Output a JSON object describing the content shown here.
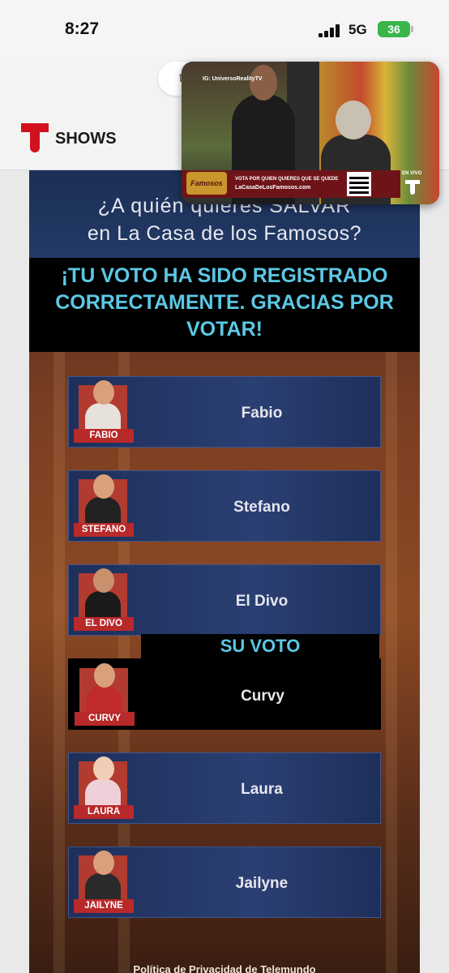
{
  "status": {
    "time": "8:27",
    "network": "5G",
    "battery": "36"
  },
  "browser": {
    "url_fragment": "t"
  },
  "header": {
    "brand": "SHOWS"
  },
  "pip": {
    "ig_handle": "IG: UniversoRealityTV",
    "show_logo": "Famosos",
    "banner_line1": "VOTA POR QUIEN QUIERES QUE SE QUEDE",
    "banner_line2": "LaCasaDeLosFamosos.com",
    "live": "EN VIVO"
  },
  "poll": {
    "title_line1": "¿A quién quieres SALVAR",
    "title_line2": "en La Casa de los Famosos?",
    "confirmation": "¡TU VOTO HA SIDO REGISTRADO CORRECTAMENTE. GRACIAS POR VOTAR!",
    "your_vote_label": "SU VOTO",
    "contestants": [
      {
        "name": "Fabio",
        "tag": "FABIO"
      },
      {
        "name": "Stefano",
        "tag": "STEFANO"
      },
      {
        "name": "El Divo",
        "tag": "EL DIVO"
      },
      {
        "name": "Curvy",
        "tag": "CURVY"
      },
      {
        "name": "Laura",
        "tag": "LAURA"
      },
      {
        "name": "Jailyne",
        "tag": "JAILYNE"
      }
    ],
    "selected": "Curvy"
  },
  "footer": {
    "privacy_link": "Política de Privacidad de Telemundo"
  },
  "colors": {
    "accent_cyan": "#5cc8e4",
    "telemundo_red": "#d3111e",
    "card_blue": "#2a3f72"
  }
}
